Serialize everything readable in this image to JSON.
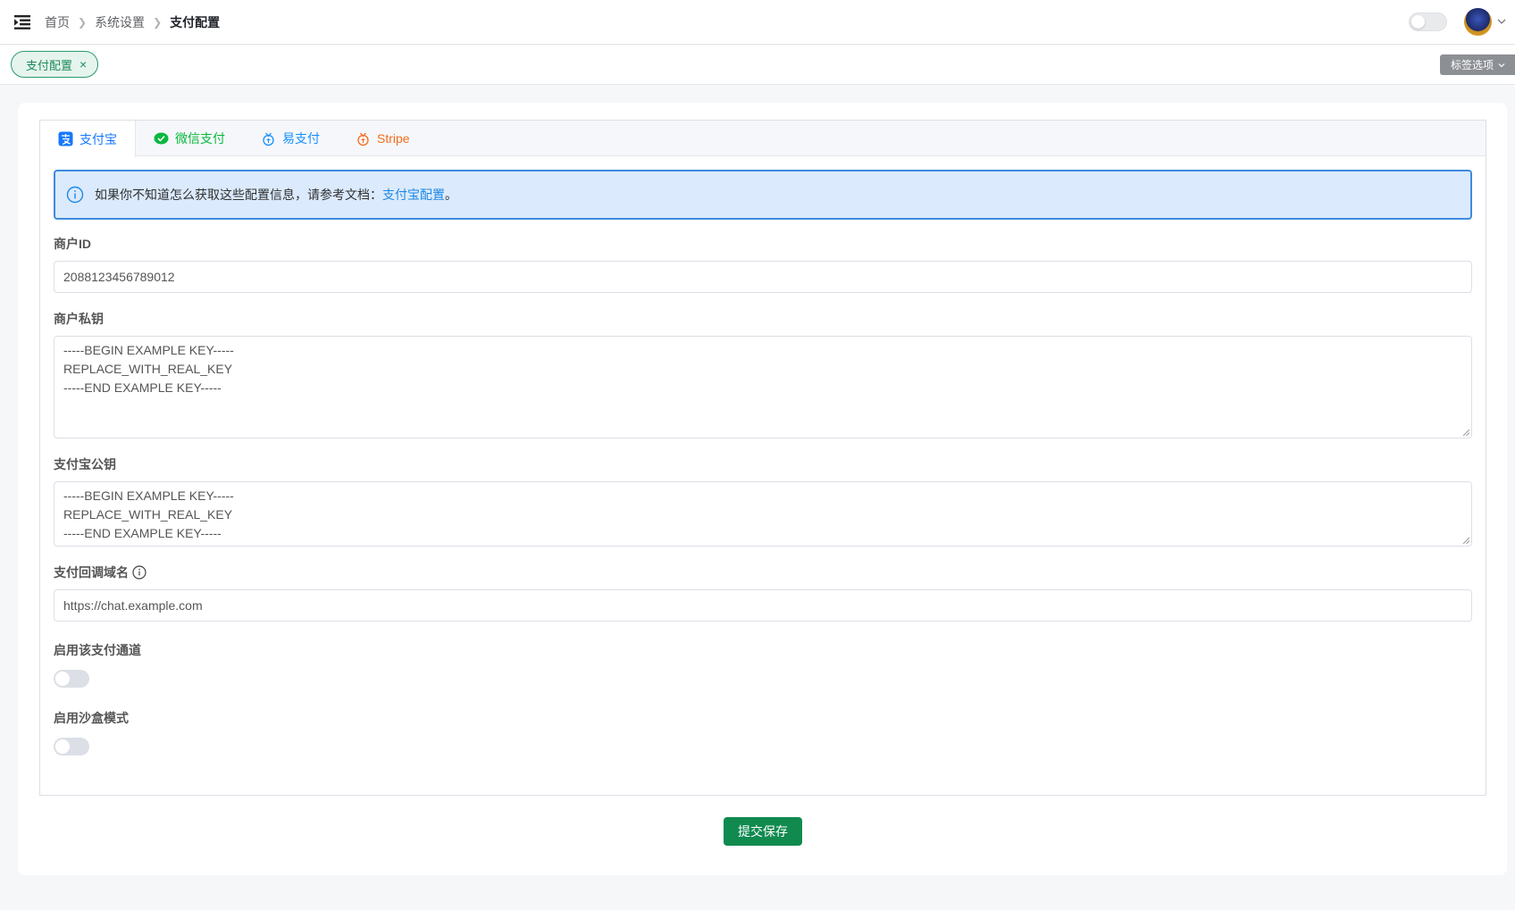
{
  "header": {
    "breadcrumb": [
      "首页",
      "系统设置",
      "支付配置"
    ],
    "menu_icon": "menu-fold-icon",
    "avatar_icon": "user-avatar"
  },
  "tagbar": {
    "active_tag": "支付配置",
    "close_symbol": "×",
    "options_label": "标签选项"
  },
  "tabs": [
    {
      "label": "支付宝",
      "icon": "alipay-icon",
      "color": "#1677ff",
      "active": true
    },
    {
      "label": "微信支付",
      "icon": "wechat-icon",
      "color": "#09b83e",
      "active": false
    },
    {
      "label": "易支付",
      "icon": "yipay-icon",
      "color": "#1890ff",
      "active": false
    },
    {
      "label": "Stripe",
      "icon": "stripe-icon",
      "color": "#f56c1a",
      "active": false
    }
  ],
  "alert": {
    "text": "如果你不知道怎么获取这些配置信息，请参考文档：",
    "link": "支付宝配置",
    "suffix": "。"
  },
  "form": {
    "merchant_id_label": "商户ID",
    "merchant_id_value": "2088123456789012",
    "private_key_label": "商户私钥",
    "private_key_lines": [
      "-----BEGIN EXAMPLE KEY-----",
      "REPLACE_WITH_REAL_KEY",
      "-----END EXAMPLE KEY-----"
    ],
    "public_key_label": "支付宝公钥",
    "public_key_lines": [
      "-----BEGIN EXAMPLE KEY-----",
      "REPLACE_WITH_REAL_KEY",
      "-----END EXAMPLE KEY-----"
    ],
    "callback_label": "支付回调域名",
    "callback_value": "https://chat.example.com",
    "enable_label": "启用该支付通道",
    "enable_value": false,
    "sandbox_label": "启用沙盒模式",
    "sandbox_value": false
  },
  "submit_label": "提交保存",
  "colors": {
    "brand": "#108a4f",
    "alert_border": "#3f8be0",
    "alert_bg": "#dbeafc"
  }
}
